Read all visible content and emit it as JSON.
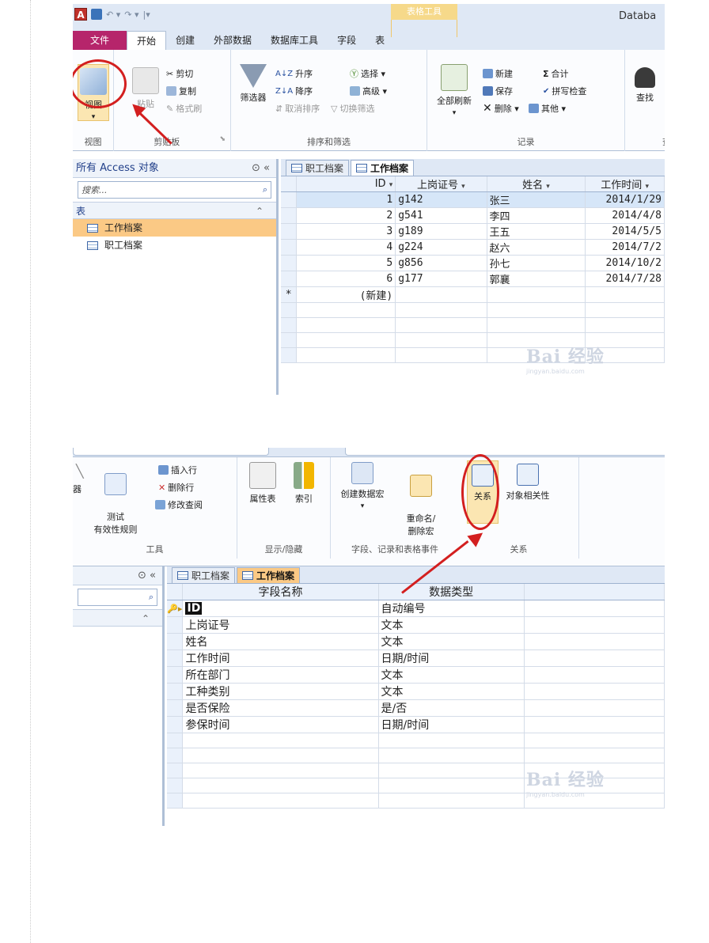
{
  "screenshot1": {
    "app_title": "Databa",
    "context_tab": "表格工具",
    "tabs": [
      "文件",
      "开始",
      "创建",
      "外部数据",
      "数据库工具",
      "字段",
      "表"
    ],
    "groups": {
      "view": {
        "label": "视图",
        "button": "视图"
      },
      "clipboard": {
        "label": "剪贴板",
        "paste": "粘贴",
        "cut": "剪切",
        "copy": "复制",
        "format_painter": "格式刷"
      },
      "sort_filter": {
        "label": "排序和筛选",
        "filter": "筛选器",
        "asc": "升序",
        "desc": "降序",
        "clear_sort": "取消排序",
        "selection": "选择 ▾",
        "advanced": "高级 ▾",
        "toggle_filter": "切换筛选"
      },
      "records": {
        "label": "记录",
        "refresh_all": "全部刷新",
        "new": "新建",
        "save": "保存",
        "delete": "删除 ▾",
        "totals": "合计",
        "spelling": "拼写检查",
        "more": "其他 ▾"
      },
      "find": {
        "label": "查",
        "find": "查找"
      }
    },
    "nav": {
      "title": "所有 Access 对象",
      "search_placeholder": "搜索...",
      "section": "表",
      "items": [
        "工作档案",
        "职工档案"
      ]
    },
    "doc_tabs": [
      "职工档案",
      "工作档案"
    ],
    "columns": [
      "ID",
      "上岗证号",
      "姓名",
      "工作时间"
    ],
    "rows": [
      [
        "1",
        "g142",
        "张三",
        "2014/1/29"
      ],
      [
        "2",
        "g541",
        "李四",
        "2014/4/8"
      ],
      [
        "3",
        "g189",
        "王五",
        "2014/5/5"
      ],
      [
        "4",
        "g224",
        "赵六",
        "2014/7/2"
      ],
      [
        "5",
        "g856",
        "孙七",
        "2014/10/2"
      ],
      [
        "6",
        "g177",
        "郭襄",
        "2014/7/28"
      ]
    ],
    "new_row": "(新建)",
    "new_marker": "*",
    "watermark": "Bai 经验",
    "watermark_url": "jingyan.baidu.com"
  },
  "screenshot2": {
    "tools": {
      "label": "工具",
      "validator": "器",
      "test_rules": "测试\n有效性规则",
      "insert_row": "插入行",
      "delete_row": "删除行",
      "modify_lookup": "修改查阅"
    },
    "show_hide": {
      "label": "显示/隐藏",
      "property_sheet": "属性表",
      "indexes": "索引"
    },
    "field_events": {
      "label": "字段、记录和表格事件",
      "create_macro": "创建数据宏",
      "rename_macro": "重命名/\n删除宏"
    },
    "relations": {
      "label": "关系",
      "relationships": "关系",
      "dependencies": "对象相关性"
    },
    "doc_tabs": [
      "职工档案",
      "工作档案"
    ],
    "columns": [
      "字段名称",
      "数据类型"
    ],
    "fields": [
      [
        "ID",
        "自动编号"
      ],
      [
        "上岗证号",
        "文本"
      ],
      [
        "姓名",
        "文本"
      ],
      [
        "工作时间",
        "日期/时间"
      ],
      [
        "所在部门",
        "文本"
      ],
      [
        "工种类别",
        "文本"
      ],
      [
        "是否保险",
        "是/否"
      ],
      [
        "参保时间",
        "日期/时间"
      ]
    ],
    "watermark": "Bai 经验",
    "watermark_url": "jingyan.baidu.com"
  },
  "colors": {
    "file_tab": "#b6256b",
    "ribbon_bg": "#fbfcfe",
    "selected_nav": "#fbc985",
    "highlight_red": "#d31f1f",
    "context_tab": "#f6d98a"
  }
}
